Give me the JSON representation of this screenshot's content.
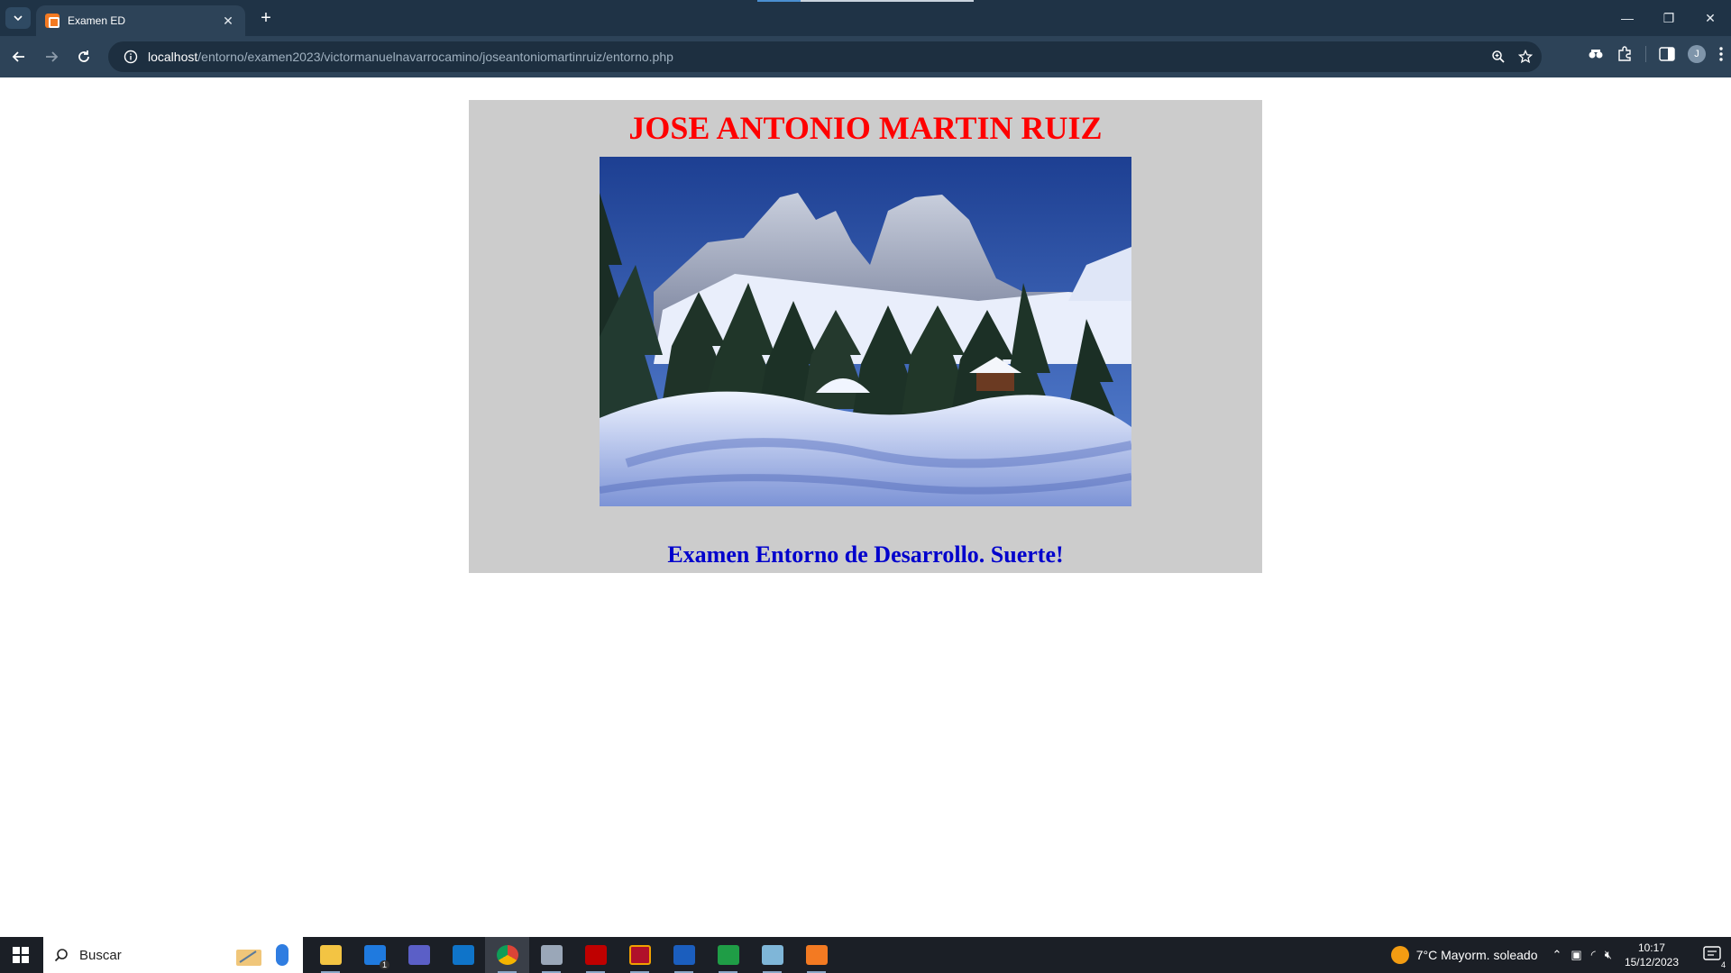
{
  "browser": {
    "tab_title": "Examen ED",
    "url_host": "localhost",
    "url_path": "/entorno/examen2023/victormanuelnavarrocamino/joseantoniomartinruiz/entorno.php",
    "profile_initial": "J"
  },
  "page": {
    "heading": "JOSE ANTONIO MARTIN RUIZ",
    "subheading": "Examen Entorno de Desarrollo. Suerte!",
    "heading_color": "#ff0000",
    "subheading_color": "#0000cc",
    "card_background": "#cccccc",
    "image_icon": "snowy-mountain-landscape"
  },
  "taskbar": {
    "search_placeholder": "Buscar",
    "weather": "7°C  Mayorm. soleado",
    "time": "10:17",
    "date": "15/12/2023",
    "notification_count": "4",
    "mail_badge": "1"
  }
}
